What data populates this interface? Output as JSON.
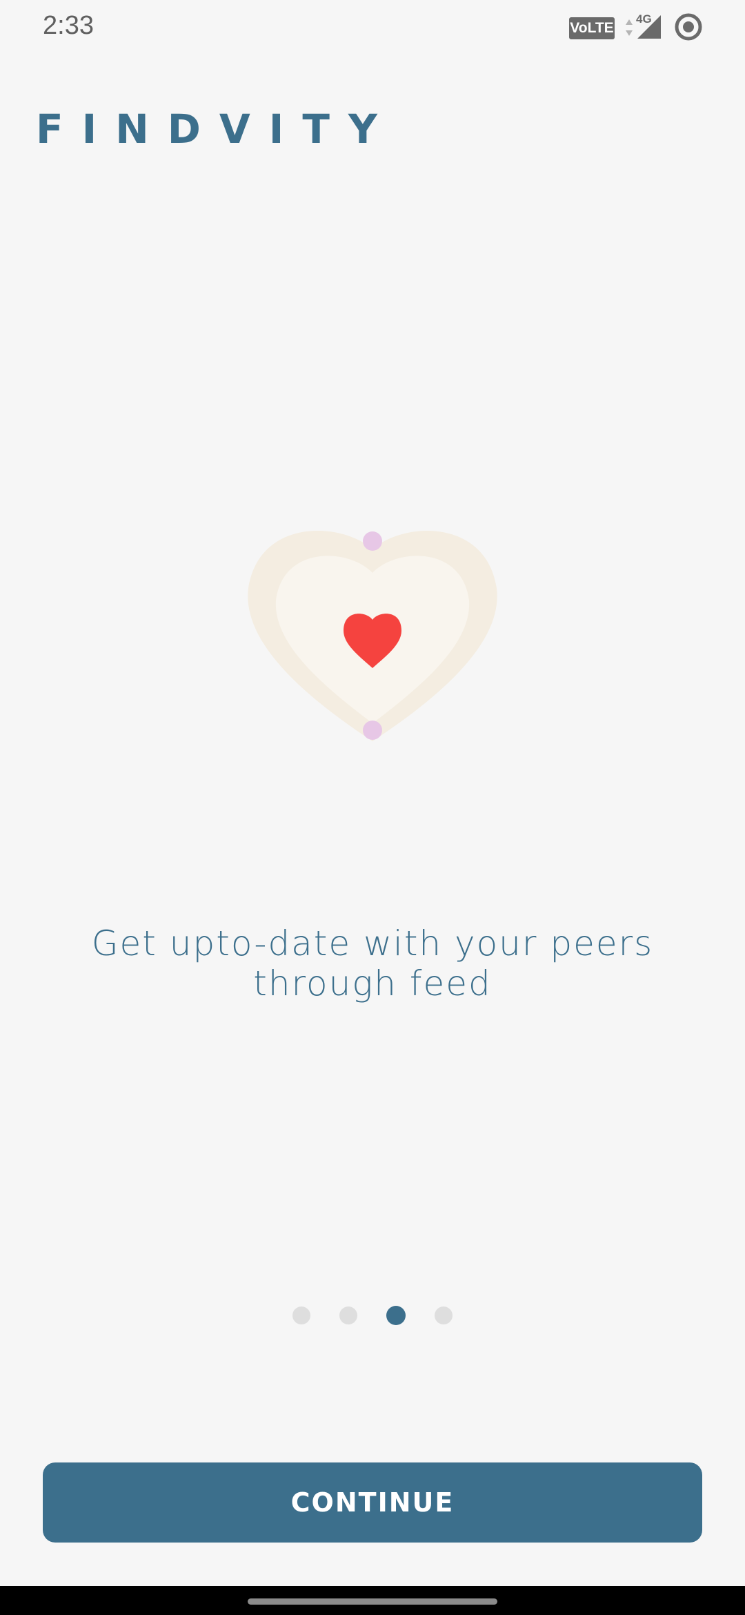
{
  "status_bar": {
    "time": "2:33",
    "volte_label": "VoLTE",
    "network_type": "4G",
    "icons": [
      "volte-icon",
      "data-arrows-icon",
      "signal-icon",
      "sync-icon"
    ]
  },
  "app": {
    "logo_text": "FINDVITY",
    "brand_color": "#3c6f8c"
  },
  "illustration": {
    "icon": "heart-icon",
    "heart_color": "#f5433f",
    "outer_color": "#f4ede1",
    "inner_color": "#f9f5ee",
    "dot_color": "#e7c7e6"
  },
  "onboarding": {
    "message": "Get upto-date with your peers through feed",
    "pages_total": 4,
    "current_page": 3
  },
  "actions": {
    "continue_label": "CONTINUE"
  }
}
